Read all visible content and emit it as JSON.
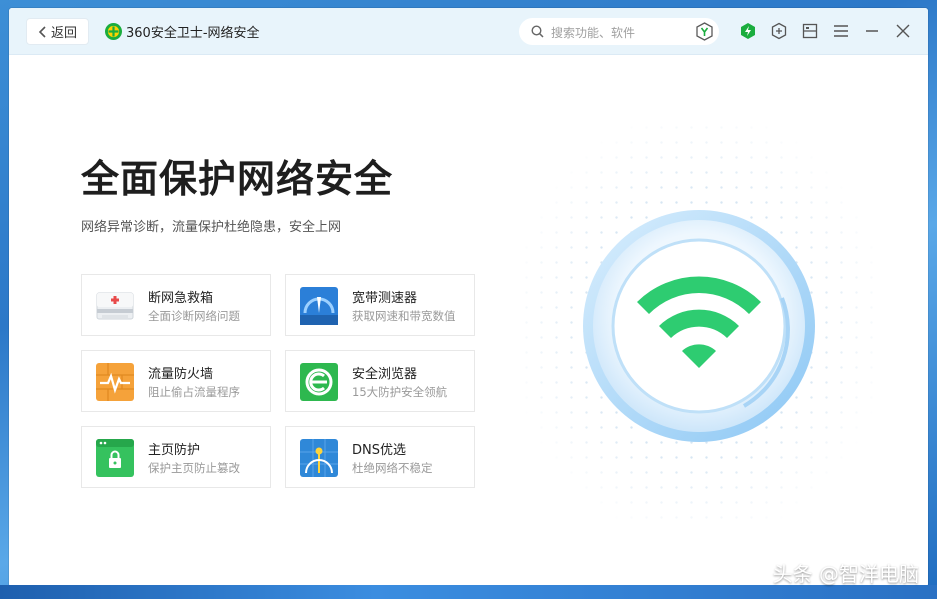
{
  "titlebar": {
    "back_label": "返回",
    "app_title": "360安全卫士-网络安全",
    "search_placeholder": "搜索功能、软件"
  },
  "hero": {
    "title": "全面保护网络安全",
    "subtitle": "网络异常诊断，流量保护杜绝隐患，安全上网"
  },
  "tools": [
    {
      "name": "断网急救箱",
      "desc": "全面诊断网络问题",
      "icon": "first-aid-kit-icon"
    },
    {
      "name": "宽带测速器",
      "desc": "获取网速和带宽数值",
      "icon": "speedometer-icon"
    },
    {
      "name": "流量防火墙",
      "desc": "阻止偷占流量程序",
      "icon": "firewall-icon"
    },
    {
      "name": "安全浏览器",
      "desc": "15大防护安全领航",
      "icon": "browser-icon"
    },
    {
      "name": "主页防护",
      "desc": "保护主页防止篡改",
      "icon": "homepage-lock-icon"
    },
    {
      "name": "DNS优选",
      "desc": "杜绝网络不稳定",
      "icon": "dns-globe-icon"
    }
  ],
  "watermark": "头条 @智洋电脑",
  "colors": {
    "titlebar_bg": "#e8f4fb",
    "wifi_green": "#2ecc71",
    "accent_green": "#1aad3e",
    "card_border": "#e8e8e8"
  }
}
